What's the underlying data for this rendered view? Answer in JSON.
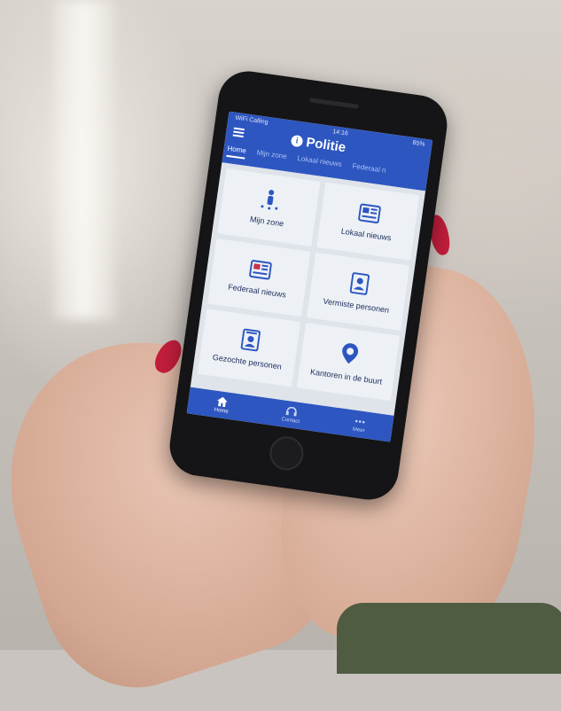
{
  "status": {
    "carrier": "WiFi Calling",
    "time": "14:16",
    "battery": "85%"
  },
  "app": {
    "title": "Politie"
  },
  "tabs": [
    {
      "label": "Home"
    },
    {
      "label": "Mijn zone"
    },
    {
      "label": "Lokaal nieuws"
    },
    {
      "label": "Federaal n"
    }
  ],
  "tiles": [
    {
      "label": "Mijn zone",
      "icon": "person-zone-icon"
    },
    {
      "label": "Lokaal nieuws",
      "icon": "newspaper-icon"
    },
    {
      "label": "Federaal nieuws",
      "icon": "newspaper-icon"
    },
    {
      "label": "Vermiste personen",
      "icon": "id-card-icon"
    },
    {
      "label": "Gezochte personen",
      "icon": "wanted-poster-icon"
    },
    {
      "label": "Kantoren in de buurt",
      "icon": "location-pin-icon"
    }
  ],
  "bottom_nav": [
    {
      "label": "Home",
      "icon": "home-icon"
    },
    {
      "label": "Contact",
      "icon": "headset-icon"
    },
    {
      "label": "Meer",
      "icon": "more-icon"
    }
  ],
  "colors": {
    "brand": "#2d56c0",
    "nail": "#c21e3c"
  }
}
